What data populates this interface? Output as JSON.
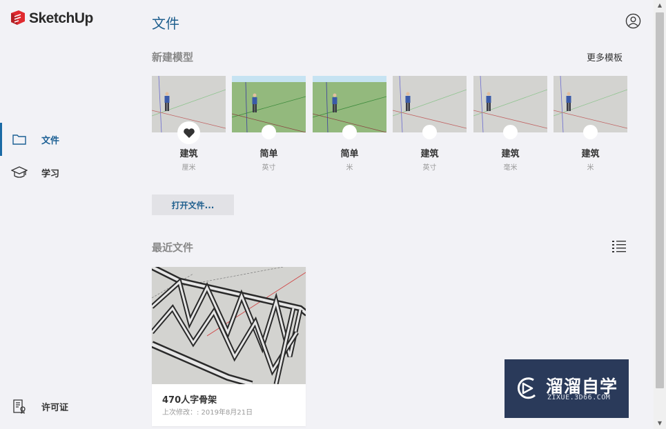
{
  "app": {
    "name": "SketchUp"
  },
  "sidebar": {
    "items": [
      {
        "label": "文件",
        "icon": "folder-icon",
        "active": true
      },
      {
        "label": "学习",
        "icon": "graduation-cap-icon",
        "active": false
      },
      {
        "label": "许可证",
        "icon": "license-icon",
        "active": false
      }
    ]
  },
  "main": {
    "title": "文件",
    "new_model": {
      "title": "新建模型",
      "more_templates": "更多模板",
      "templates": [
        {
          "name": "建筑",
          "unit": "厘米",
          "style": "gray",
          "favorite": true
        },
        {
          "name": "简单",
          "unit": "英寸",
          "style": "green",
          "favorite": false
        },
        {
          "name": "简单",
          "unit": "米",
          "style": "green",
          "favorite": false
        },
        {
          "name": "建筑",
          "unit": "英寸",
          "style": "gray",
          "favorite": false
        },
        {
          "name": "建筑",
          "unit": "毫米",
          "style": "gray",
          "favorite": false
        },
        {
          "name": "建筑",
          "unit": "米",
          "style": "gray",
          "favorite": false
        }
      ]
    },
    "open_button": "打开文件...",
    "recent": {
      "title": "最近文件",
      "files": [
        {
          "name": "470人字骨架",
          "modified": "上次修改：: 2019年8月21日"
        }
      ]
    }
  },
  "watermark": {
    "title": "溜溜自学",
    "subtitle": "ZIXUE.3D66.COM"
  },
  "colors": {
    "accent": "#1f5f8e",
    "active_bar": "#1b6aa5",
    "logo_red": "#e02a2f",
    "watermark_bg": "#2a3a5a"
  }
}
